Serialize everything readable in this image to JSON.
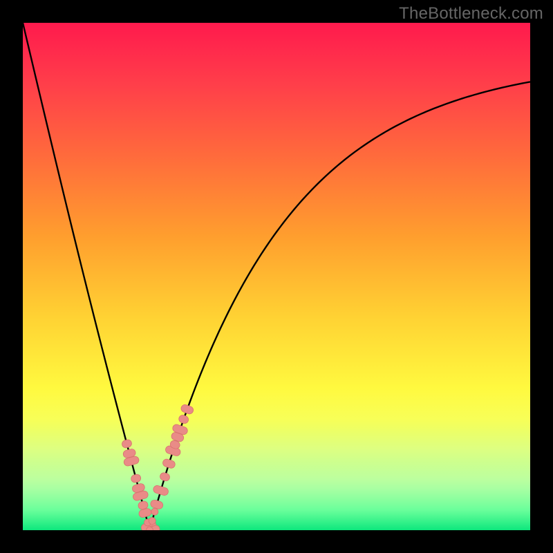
{
  "watermark": "TheBottleneck.com",
  "colors": {
    "curve_stroke": "#000000",
    "marker_fill": "#e98b87",
    "marker_stroke": "#d9736f",
    "bg_black": "#000000"
  },
  "chart_data": {
    "type": "line",
    "title": "",
    "xlabel": "",
    "ylabel": "",
    "x": [
      0,
      4,
      8,
      12,
      16,
      20,
      24,
      25,
      32,
      40,
      48,
      56,
      64,
      72,
      80,
      88,
      96,
      100
    ],
    "values": [
      100,
      82,
      64,
      46,
      28,
      10,
      2,
      0,
      12,
      30,
      45,
      56,
      65,
      72,
      78,
      83,
      87,
      89
    ],
    "xlim": [
      0,
      100
    ],
    "ylim": [
      0,
      100
    ],
    "minimum_x": 25,
    "markers": {
      "left_cluster_x": [
        20.5,
        21.0,
        21.4,
        22.3,
        22.8,
        23.2,
        23.7,
        24.1,
        24.8,
        25.3,
        25.8
      ],
      "right_cluster_x": [
        26.4,
        27.2,
        28.0,
        28.8,
        29.6,
        30.0,
        30.5,
        31.0,
        31.7,
        32.4
      ],
      "generic_y_hint": [
        32,
        30,
        28,
        23,
        21,
        19,
        16,
        13,
        8,
        5,
        3,
        3,
        6,
        10,
        13,
        16,
        18,
        20,
        22,
        25,
        28
      ]
    }
  }
}
